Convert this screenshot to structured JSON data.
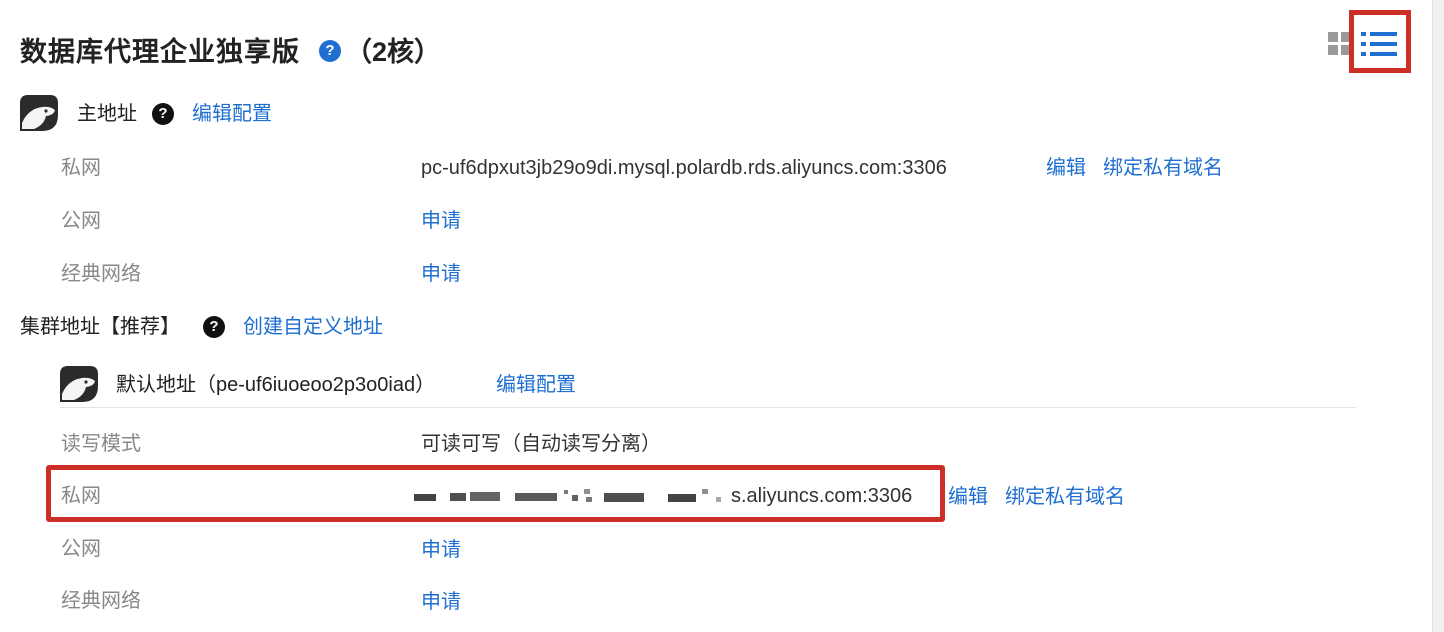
{
  "header": {
    "title": "数据库代理企业独享版",
    "help_icon": "help-circle-icon",
    "suffix": "（2核）",
    "view_toggle": {
      "grid_icon": "grid-icon",
      "list_icon": "list-icon",
      "active": "list"
    }
  },
  "primary_address": {
    "icon": "polardb-bear-icon",
    "title": "主地址",
    "help_icon": "help-circle-icon",
    "edit_link": "编辑配置",
    "rows": [
      {
        "label": "私网",
        "value": "pc-uf6dpxut3jb29o9di.mysql.polardb.rds.aliyuncs.com:3306",
        "links": [
          "编辑",
          "绑定私有域名"
        ]
      },
      {
        "label": "公网",
        "value": "",
        "links": [
          "申请"
        ]
      },
      {
        "label": "经典网络",
        "value": "",
        "links": [
          "申请"
        ]
      }
    ]
  },
  "cluster_address": {
    "title": "集群地址【推荐】",
    "help_icon": "help-circle-icon",
    "create_link": "创建自定义地址",
    "default_endpoint": {
      "icon": "polardb-bear-icon",
      "title": "默认地址（pe-uf6iuoeoo2p3o0iad）",
      "edit_link": "编辑配置"
    },
    "rows": [
      {
        "label": "读写模式",
        "value": "可读可写（自动读写分离）",
        "links": []
      },
      {
        "label": "私网",
        "value": "s.aliyuncs.com:3306",
        "links": [
          "编辑",
          "绑定私有域名"
        ]
      },
      {
        "label": "公网",
        "value": "",
        "links": [
          "申请"
        ]
      },
      {
        "label": "经典网络",
        "value": "",
        "links": [
          "申请"
        ]
      }
    ]
  },
  "colors": {
    "link": "#1f6fd1",
    "highlight_border": "#cc2f26",
    "label": "#888888",
    "text": "#333333"
  }
}
